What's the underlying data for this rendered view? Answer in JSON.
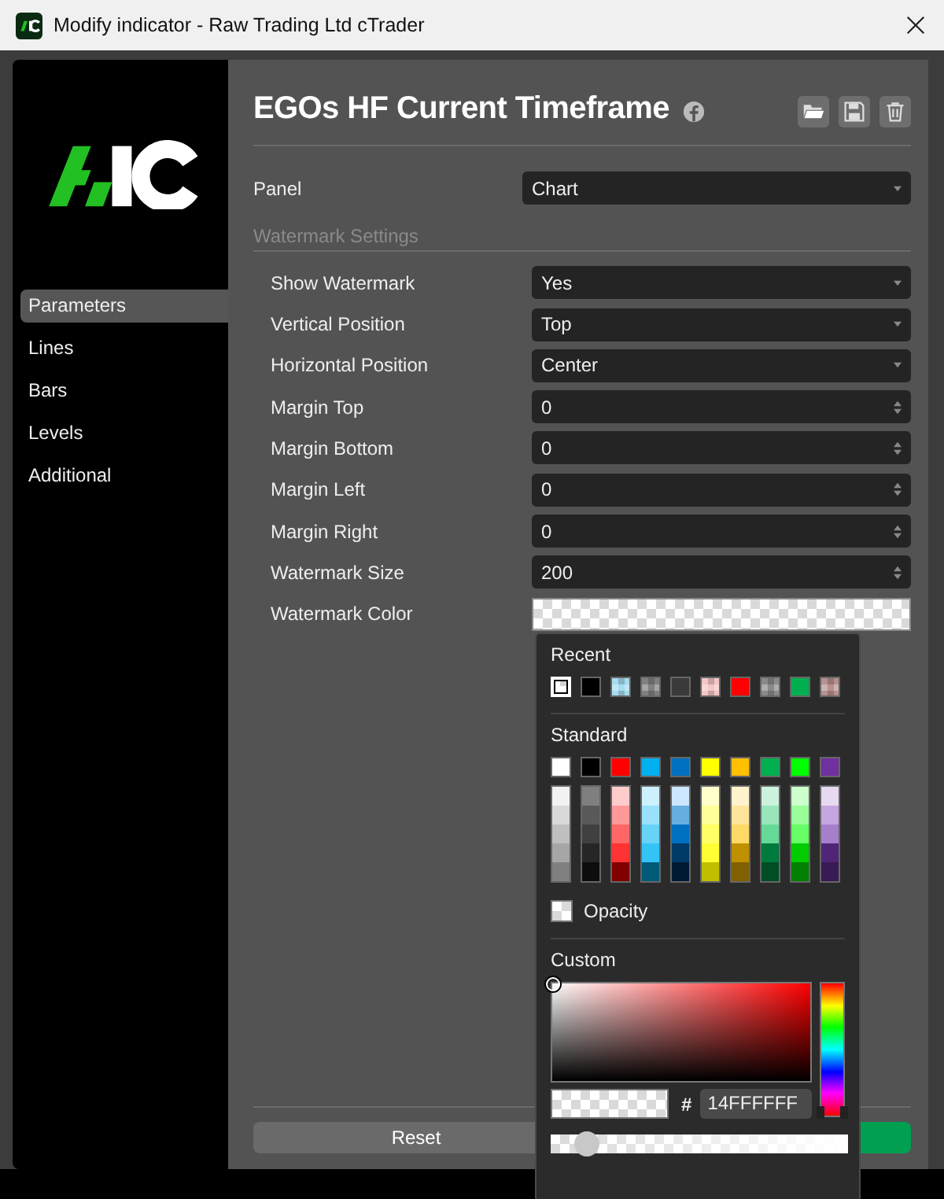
{
  "window": {
    "title": "Modify indicator - Raw Trading Ltd cTrader"
  },
  "sidebar": {
    "items": [
      {
        "label": "Parameters",
        "selected": true
      },
      {
        "label": "Lines",
        "selected": false
      },
      {
        "label": "Bars",
        "selected": false
      },
      {
        "label": "Levels",
        "selected": false
      },
      {
        "label": "Additional",
        "selected": false
      }
    ]
  },
  "header": {
    "title": "EGOs HF Current Timeframe"
  },
  "settings": [
    {
      "kind": "dropdown",
      "label": "Panel",
      "value": "Chart"
    },
    {
      "kind": "section",
      "label": "Watermark Settings",
      "children": [
        {
          "kind": "dropdown",
          "label": "Show Watermark",
          "value": "Yes"
        },
        {
          "kind": "dropdown",
          "label": "Vertical Position",
          "value": "Top"
        },
        {
          "kind": "dropdown",
          "label": "Horizontal Position",
          "value": "Center"
        },
        {
          "kind": "number",
          "label": "Margin Top",
          "value": "0"
        },
        {
          "kind": "number",
          "label": "Margin Bottom",
          "value": "0"
        },
        {
          "kind": "number",
          "label": "Margin Left",
          "value": "0"
        },
        {
          "kind": "number",
          "label": "Margin Right",
          "value": "0"
        },
        {
          "kind": "number",
          "label": "Watermark Size",
          "value": "200"
        },
        {
          "kind": "color",
          "label": "Watermark Color"
        }
      ]
    }
  ],
  "buttons": [
    {
      "kind": "reset",
      "label": "Reset"
    },
    {
      "kind": "confirm"
    }
  ],
  "color_picker": {
    "recent_label": "Recent",
    "recent": [
      {
        "color": "#ffffff",
        "transparent": true,
        "selected": true
      },
      {
        "color": "#000000",
        "transparent": false,
        "selected": false
      },
      {
        "color": "#a6dcf0",
        "transparent": true,
        "selected": false
      },
      {
        "color": "#808080",
        "transparent": true,
        "selected": false
      },
      {
        "color": "#3a3a3a",
        "transparent": false,
        "selected": false
      },
      {
        "color": "#f4c6c6",
        "transparent": true,
        "selected": false
      },
      {
        "color": "#ff0000",
        "transparent": false,
        "selected": false
      },
      {
        "color": "#8a8a8a",
        "transparent": true,
        "selected": false
      },
      {
        "color": "#00b050",
        "transparent": false,
        "selected": false
      },
      {
        "color": "#b89090",
        "transparent": true,
        "selected": false
      }
    ],
    "standard_label": "Standard",
    "standard": [
      {
        "color": "#ffffff",
        "shades": [
          {
            "color": "#f2f2f2"
          },
          {
            "color": "#d9d9d9"
          },
          {
            "color": "#bfbfbf"
          },
          {
            "color": "#a6a6a6"
          },
          {
            "color": "#808080"
          }
        ]
      },
      {
        "color": "#000000",
        "shades": [
          {
            "color": "#7f7f7f"
          },
          {
            "color": "#595959"
          },
          {
            "color": "#404040"
          },
          {
            "color": "#262626"
          },
          {
            "color": "#0d0d0d"
          }
        ]
      },
      {
        "color": "#ff0000",
        "shades": [
          {
            "color": "#ffcccc"
          },
          {
            "color": "#ff9999"
          },
          {
            "color": "#ff6666"
          },
          {
            "color": "#ff3333"
          },
          {
            "color": "#800000"
          }
        ]
      },
      {
        "color": "#00b0f0",
        "shades": [
          {
            "color": "#ccf0fc"
          },
          {
            "color": "#99e1fa"
          },
          {
            "color": "#66d3f7"
          },
          {
            "color": "#33c4f5"
          },
          {
            "color": "#005a78"
          }
        ]
      },
      {
        "color": "#0070c0",
        "shades": [
          {
            "color": "#cce6ff"
          },
          {
            "color": "#66aee0"
          },
          {
            "color": "#0070c0"
          },
          {
            "color": "#003a66"
          },
          {
            "color": "#001a33"
          }
        ]
      },
      {
        "color": "#ffff00",
        "shades": [
          {
            "color": "#ffffcc"
          },
          {
            "color": "#ffff99"
          },
          {
            "color": "#ffff66"
          },
          {
            "color": "#ffff33"
          },
          {
            "color": "#bfbf00"
          }
        ]
      },
      {
        "color": "#ffc000",
        "shades": [
          {
            "color": "#fff2cc"
          },
          {
            "color": "#ffe599"
          },
          {
            "color": "#ffd966"
          },
          {
            "color": "#bf9000"
          },
          {
            "color": "#806000"
          }
        ]
      },
      {
        "color": "#00b050",
        "shades": [
          {
            "color": "#ccf2dd"
          },
          {
            "color": "#99e6bb"
          },
          {
            "color": "#66d999"
          },
          {
            "color": "#007a3d"
          },
          {
            "color": "#004d26"
          }
        ]
      },
      {
        "color": "#00ff00",
        "shades": [
          {
            "color": "#ccffcc"
          },
          {
            "color": "#99ff99"
          },
          {
            "color": "#66ff66"
          },
          {
            "color": "#00cc00"
          },
          {
            "color": "#008000"
          }
        ]
      },
      {
        "color": "#7030a0",
        "shades": [
          {
            "color": "#e6d9f0"
          },
          {
            "color": "#c6a6e0"
          },
          {
            "color": "#a67fcc"
          },
          {
            "color": "#502578"
          },
          {
            "color": "#381a54"
          }
        ]
      }
    ],
    "opacity_label": "Opacity",
    "custom_label": "Custom",
    "hex_prefix": "#",
    "hex": "14FFFFFF",
    "alpha": {
      "level": 0.08
    }
  }
}
